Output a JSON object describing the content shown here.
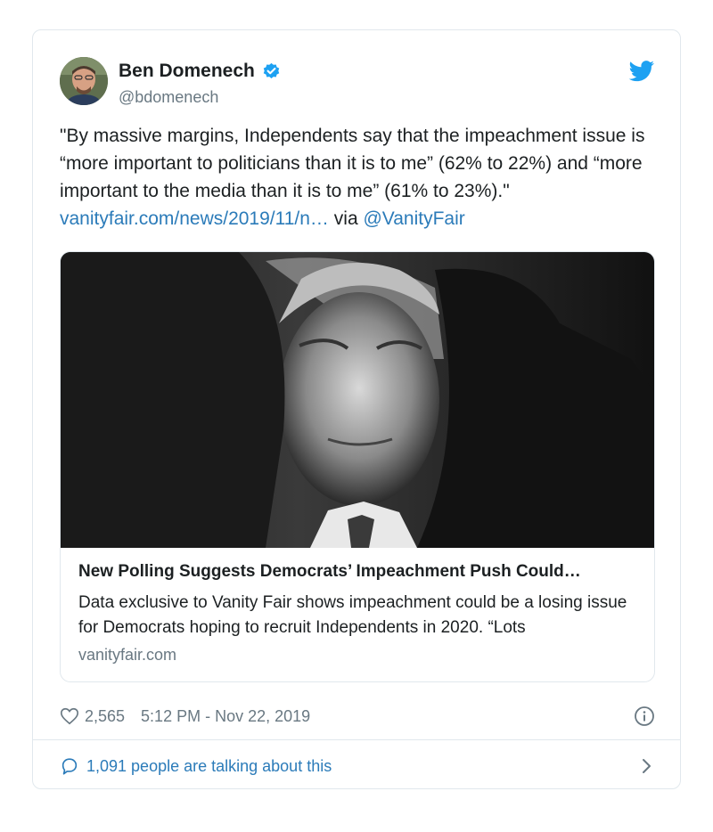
{
  "author": {
    "name": "Ben Domenech",
    "handle": "@bdomenech"
  },
  "tweet": {
    "text_before": "\"By massive margins, Independents say that the impeachment issue is “more important to politicians than it is to me” (62% to 22%) and “more important to the media than it is to me” (61% to 23%).\" ",
    "link": "vanityfair.com/news/2019/11/n…",
    "via": " via ",
    "mention": "@VanityFair"
  },
  "card": {
    "title": "New Polling Suggests Democrats’ Impeachment Push Could…",
    "description": "Data exclusive to Vanity Fair shows impeachment could be a losing issue for Democrats hoping to recruit Independents in 2020. “Lots",
    "domain": "vanityfair.com"
  },
  "meta": {
    "likes": "2,565",
    "timestamp": "5:12 PM - Nov 22, 2019"
  },
  "footer": {
    "talking": "1,091 people are talking about this"
  },
  "colors": {
    "link": "#2b7bb9",
    "muted": "#697882",
    "text": "#1c2022",
    "verified": "#1da1f2"
  },
  "icons": [
    "verified-badge-icon",
    "twitter-bird-icon",
    "heart-icon",
    "info-icon",
    "comment-bubble-icon",
    "chevron-right-icon"
  ]
}
